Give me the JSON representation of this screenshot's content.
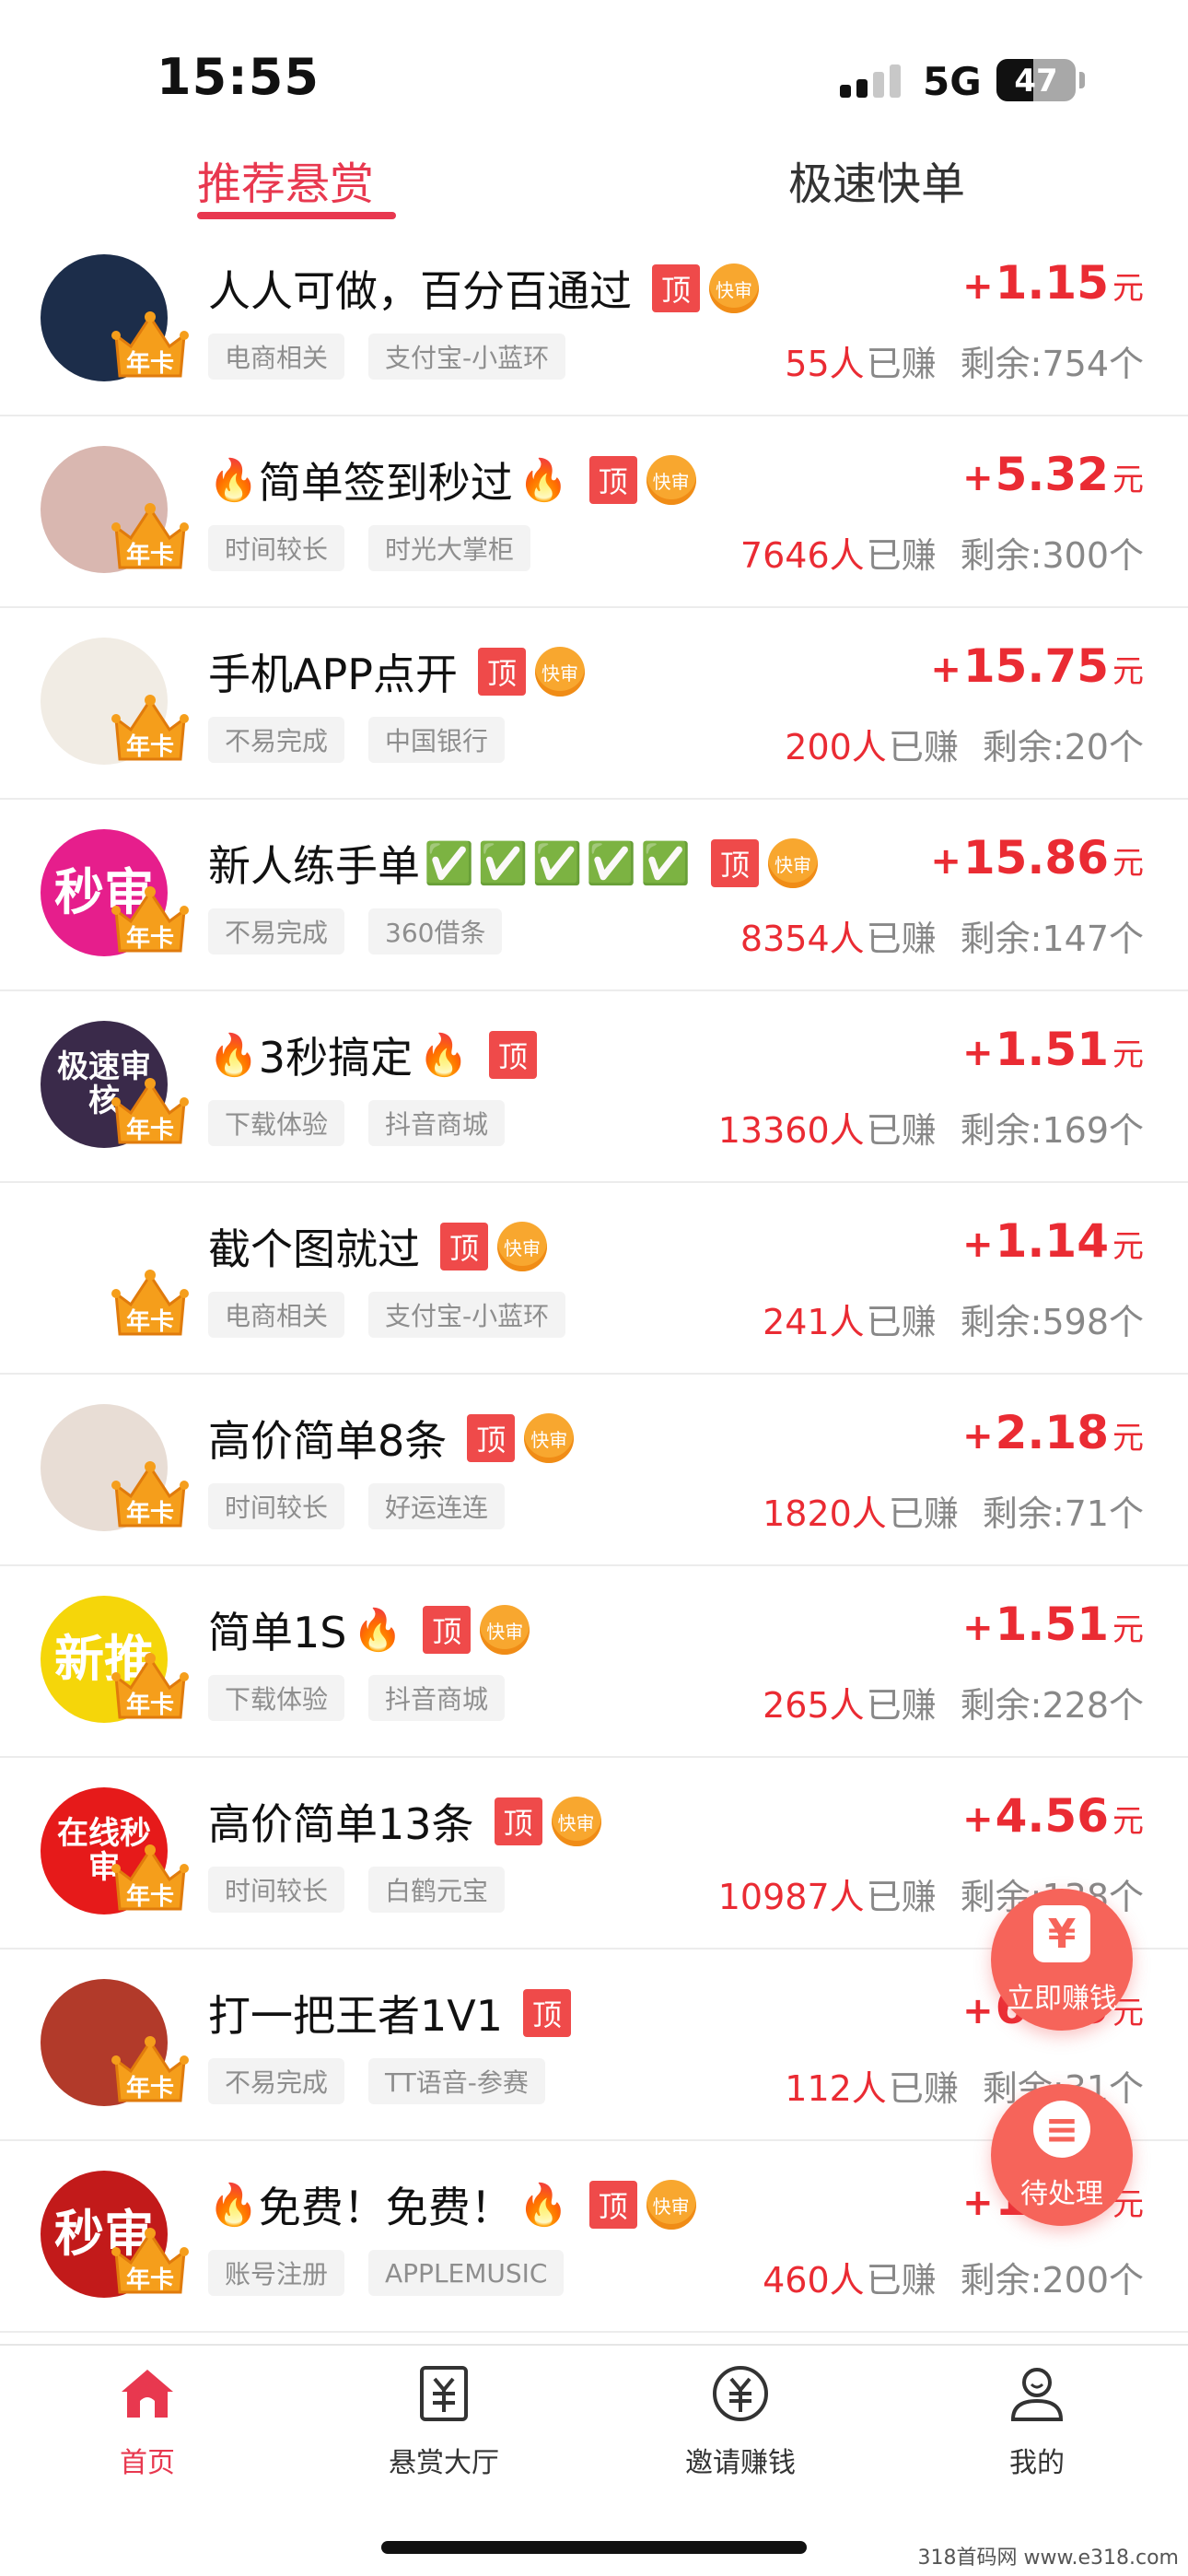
{
  "status_bar": {
    "time": "15:55",
    "network": "5G",
    "battery": "47",
    "battery_level": 0.47
  },
  "tabs": [
    {
      "label": "推荐悬赏",
      "active": true
    },
    {
      "label": "极速快单",
      "active": false
    }
  ],
  "badge_labels": {
    "top": "顶",
    "fast": "快审",
    "crown": "年卡"
  },
  "tasks": [
    {
      "title": "人人可做，百分百通过",
      "fire_before": false,
      "fire_after": false,
      "checks": 0,
      "fast": true,
      "tags": [
        "电商相关",
        "支付宝-小蓝环"
      ],
      "reward": "1.15",
      "count": "55人",
      "remain": "剩余:754个",
      "avatar_text": "",
      "avatar_color": "#1c2d4a"
    },
    {
      "title": "简单签到秒过",
      "fire_before": true,
      "fire_after": true,
      "checks": 0,
      "fast": true,
      "tags": [
        "时间较长",
        "时光大掌柜"
      ],
      "reward": "5.32",
      "count": "7646人",
      "remain": "剩余:300个",
      "avatar_text": "",
      "avatar_color": "#d9b7b0"
    },
    {
      "title": "手机APP点开",
      "fire_before": false,
      "fire_after": false,
      "checks": 0,
      "fast": true,
      "tags": [
        "不易完成",
        "中国银行"
      ],
      "reward": "15.75",
      "count": "200人",
      "remain": "剩余:20个",
      "avatar_text": "",
      "avatar_color": "#f1ece4"
    },
    {
      "title": "新人练手单",
      "fire_before": false,
      "fire_after": false,
      "checks": 5,
      "fast": true,
      "tags": [
        "不易完成",
        "360借条"
      ],
      "reward": "15.86",
      "count": "8354人",
      "remain": "剩余:147个",
      "avatar_text": "秒审",
      "avatar_color": "#e61e8c"
    },
    {
      "title": "3秒搞定",
      "fire_before": true,
      "fire_after": true,
      "checks": 0,
      "fast": false,
      "tags": [
        "下载体验",
        "抖音商城"
      ],
      "reward": "1.51",
      "count": "13360人",
      "remain": "剩余:169个",
      "avatar_text": "极速审核",
      "avatar_color": "#3a2a4a"
    },
    {
      "title": "截个图就过",
      "fire_before": false,
      "fire_after": false,
      "checks": 0,
      "fast": true,
      "tags": [
        "电商相关",
        "支付宝-小蓝环"
      ],
      "reward": "1.14",
      "count": "241人",
      "remain": "剩余:598个",
      "avatar_text": "",
      "avatar_color": "#ffffff"
    },
    {
      "title": "高价简单8条",
      "fire_before": false,
      "fire_after": false,
      "checks": 0,
      "fast": true,
      "tags": [
        "时间较长",
        "好运连连"
      ],
      "reward": "2.18",
      "count": "1820人",
      "remain": "剩余:71个",
      "avatar_text": "",
      "avatar_color": "#e8ddd5"
    },
    {
      "title": "简单1S",
      "fire_before": false,
      "fire_after": true,
      "checks": 0,
      "fast": true,
      "tags": [
        "下载体验",
        "抖音商城"
      ],
      "reward": "1.51",
      "count": "265人",
      "remain": "剩余:228个",
      "avatar_text": "新推",
      "avatar_color": "#f5d60a"
    },
    {
      "title": "高价简单13条",
      "fire_before": false,
      "fire_after": false,
      "checks": 0,
      "fast": true,
      "tags": [
        "时间较长",
        "白鹤元宝"
      ],
      "reward": "4.56",
      "count": "10987人",
      "remain": "剩余:138个",
      "avatar_text": "在线秒审",
      "avatar_color": "#e61a1a"
    },
    {
      "title": "打一把王者1V1",
      "fire_before": false,
      "fire_after": false,
      "checks": 0,
      "fast": false,
      "tags": [
        "不易完成",
        "TT语音-参赛"
      ],
      "reward": "6.45",
      "count": "112人",
      "remain": "剩余:31个",
      "avatar_text": "",
      "avatar_color": "#b23a2a"
    },
    {
      "title": "免费！免费！",
      "fire_before": true,
      "fire_after": true,
      "checks": 0,
      "fast": true,
      "tags": [
        "账号注册",
        "APPLEMUSIC"
      ],
      "reward": "1.48",
      "count": "460人",
      "remain": "剩余:200个",
      "avatar_text": "秒审",
      "avatar_color": "#c21a1a"
    }
  ],
  "reward_unit": "元",
  "reward_plus": "+",
  "earned_label": "已赚",
  "fab": {
    "earn": {
      "label": "立即赚钱",
      "icon": "¥"
    },
    "pending": {
      "label": "待处理",
      "icon": "≡"
    }
  },
  "bottom_nav": [
    {
      "label": "首页",
      "icon": "home-icon",
      "active": true
    },
    {
      "label": "悬赏大厅",
      "icon": "reward-hall-icon",
      "active": false
    },
    {
      "label": "邀请赚钱",
      "icon": "invite-money-icon",
      "active": false
    },
    {
      "label": "我的",
      "icon": "profile-icon",
      "active": false
    }
  ],
  "watermark": "318首码网 www.e318.com",
  "colors": {
    "accent": "#e8384f",
    "price": "#ea2b33",
    "fab": "#f6645a"
  }
}
